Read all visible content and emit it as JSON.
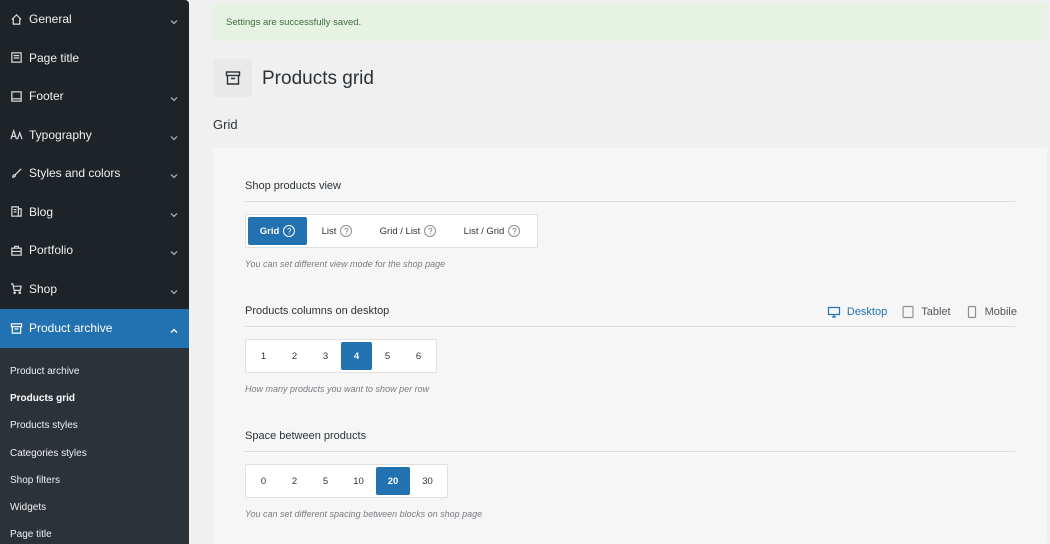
{
  "sidebar": {
    "items": [
      {
        "label": "General",
        "icon": "home-icon",
        "expanded": false,
        "has_chevron": true
      },
      {
        "label": "Page title",
        "icon": "page-title-icon",
        "expanded": false,
        "has_chevron": false
      },
      {
        "label": "Footer",
        "icon": "footer-icon",
        "expanded": false,
        "has_chevron": true
      },
      {
        "label": "Typography",
        "icon": "typography-icon",
        "expanded": false,
        "has_chevron": true
      },
      {
        "label": "Styles and colors",
        "icon": "brush-icon",
        "expanded": false,
        "has_chevron": true
      },
      {
        "label": "Blog",
        "icon": "blog-icon",
        "expanded": false,
        "has_chevron": true
      },
      {
        "label": "Portfolio",
        "icon": "briefcase-icon",
        "expanded": false,
        "has_chevron": true
      },
      {
        "label": "Shop",
        "icon": "cart-icon",
        "expanded": false,
        "has_chevron": true
      },
      {
        "label": "Product archive",
        "icon": "archive-icon",
        "expanded": true,
        "has_chevron": true
      }
    ],
    "submenu": [
      {
        "label": "Product archive",
        "current": false
      },
      {
        "label": "Products grid",
        "current": true
      },
      {
        "label": "Products styles",
        "current": false
      },
      {
        "label": "Categories styles",
        "current": false
      },
      {
        "label": "Shop filters",
        "current": false
      },
      {
        "label": "Widgets",
        "current": false
      },
      {
        "label": "Page title",
        "current": false
      }
    ]
  },
  "notice": {
    "text": "Settings are successfully saved."
  },
  "page": {
    "icon": "archive-icon",
    "title": "Products grid",
    "section": "Grid"
  },
  "fields": {
    "view": {
      "label": "Shop products view",
      "options": [
        {
          "label": "Grid",
          "selected": true
        },
        {
          "label": "List",
          "selected": false
        },
        {
          "label": "Grid / List",
          "selected": false
        },
        {
          "label": "List / Grid",
          "selected": false
        }
      ],
      "help": "You can set different view mode for the shop page"
    },
    "columns": {
      "label": "Products columns on desktop",
      "options": [
        "1",
        "2",
        "3",
        "4",
        "5",
        "6"
      ],
      "selected": "4",
      "help": "How many products you want to show per row",
      "devices": [
        {
          "label": "Desktop",
          "icon": "desktop-icon",
          "active": true
        },
        {
          "label": "Tablet",
          "icon": "tablet-icon",
          "active": false
        },
        {
          "label": "Mobile",
          "icon": "mobile-icon",
          "active": false
        }
      ]
    },
    "spacing": {
      "label": "Space between products",
      "options": [
        "0",
        "2",
        "5",
        "10",
        "20",
        "30"
      ],
      "selected": "20",
      "help": "You can set different spacing between blocks on shop page"
    }
  },
  "colors": {
    "accent": "#2271b1",
    "sidebar_bg": "#1d2327",
    "notice_bg": "#e6f2e2"
  }
}
